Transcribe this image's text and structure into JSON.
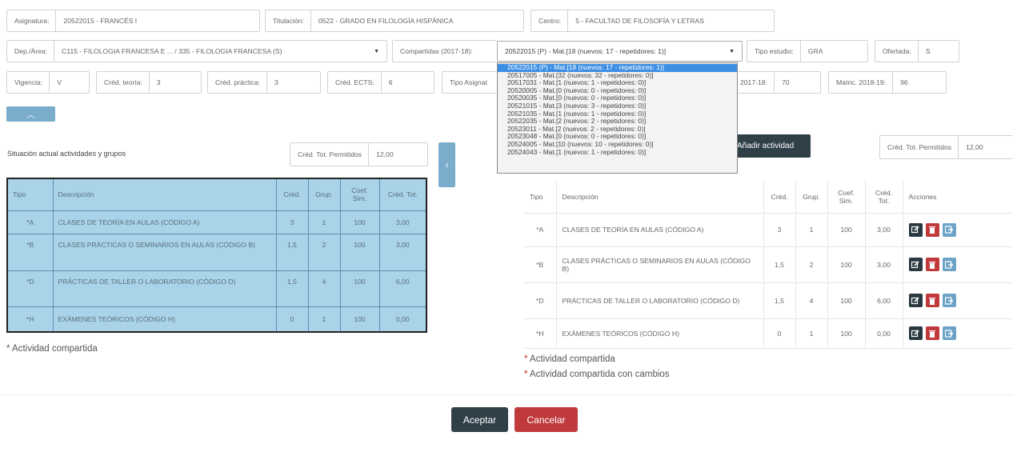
{
  "row1": {
    "asignatura": {
      "label": "Asignatura:",
      "value": "20522015 - FRANCÉS I"
    },
    "titulacion": {
      "label": "Titulación:",
      "value": "0522 - GRADO EN FILOLOGÍA HISPÁNICA"
    },
    "centro": {
      "label": "Centro:",
      "value": "5 - FACULTAD DE FILOSOFÍA Y LETRAS"
    }
  },
  "row2": {
    "dep_area": {
      "label": "Dep./Área:",
      "value": "C115 - FILOLOGIA FRANCESA E ... / 335 - FILOLOGIA FRANCESA (S)"
    },
    "compartidas": {
      "label": "Compartidas (2017-18):",
      "value": "20522015 (P) - Mat.[18 (nuevos: 17 - repetidores: 1)]"
    },
    "tipo_estudio": {
      "label": "Tipo estudio:",
      "value": "GRA"
    },
    "ofertada": {
      "label": "Ofertada:",
      "value": "S"
    }
  },
  "row3": {
    "vigencia": {
      "label": "Vigencia:",
      "value": "V"
    },
    "cred_teoria": {
      "label": "Créd. teoría:",
      "value": "3"
    },
    "cred_practica": {
      "label": "Créd. práctica:",
      "value": "3"
    },
    "cred_ects": {
      "label": "Créd. ECTS:",
      "value": "6"
    },
    "tipo_asignat": {
      "label": "Tipo Asignat"
    },
    "matric_2017": {
      "label": "2017-18:",
      "value": "70"
    },
    "matric_2018": {
      "label": "Matric. 2018-19:",
      "value": "96"
    }
  },
  "dropdown_options": [
    "20522015 (P) - Mat.[18 (nuevos: 17 - repetidores: 1)]",
    "20517005 - Mat.[32 (nuevos: 32 - repetidores: 0)]",
    "20517031 - Mat.[1 (nuevos: 1 - repetidores: 0)]",
    "20520005 - Mat.[0 (nuevos: 0 - repetidores: 0)]",
    "20520035 - Mat.[0 (nuevos: 0 - repetidores: 0)]",
    "20521015 - Mat.[3 (nuevos: 3 - repetidores: 0)]",
    "20521035 - Mat.[1 (nuevos: 1 - repetidores: 0)]",
    "20522035 - Mat.[2 (nuevos: 2 - repetidores: 0)]",
    "20523011 - Mat.[2 (nuevos: 2 - repetidores: 0)]",
    "20523048 - Mat.[0 (nuevos: 0 - repetidores: 0)]",
    "20524005 - Mat.[10 (nuevos: 10 - repetidores: 0)]",
    "20524043 - Mat.[1 (nuevos: 1 - repetidores: 0)]"
  ],
  "left": {
    "title": "Situación actual actividades y grupos",
    "cred_label": "Créd. Tot. Permitidos",
    "cred_value": "12,00",
    "headers": [
      "Tipo",
      "Descripción",
      "Créd.",
      "Grup.",
      "Coef. Sim.",
      "Créd. Tot."
    ],
    "rows": [
      [
        "*A",
        "CLASES DE TEORÍA EN AULAS (CÓDIGO A)",
        "3",
        "1",
        "100",
        "3,00"
      ],
      [
        "*B",
        "CLASES PRÁCTICAS O SEMINARIOS EN AULAS (CÓDIGO B)",
        "1,5",
        "2",
        "100",
        "3,00"
      ],
      [
        "*D",
        "PRÁCTICAS DE TALLER O LABORATORIO (CÓDIGO D)",
        "1,5",
        "4",
        "100",
        "6,00"
      ],
      [
        "*H",
        "EXÁMENES TEÓRICOS (CÓDIGO H)",
        "0",
        "1",
        "100",
        "0,00"
      ]
    ],
    "note": "* Actividad compartida"
  },
  "right": {
    "add_button": "Añadir actividad",
    "cred_label": "Créd. Tot. Permitidos",
    "cred_value": "12,00",
    "headers": [
      "Tipo",
      "Descripción",
      "Créd.",
      "Grup.",
      "Coef. Sim.",
      "Créd. Tot.",
      "Acciones"
    ],
    "rows": [
      [
        "*A",
        "CLASES DE TEORÍA EN AULAS (CÓDIGO A)",
        "3",
        "1",
        "100",
        "3,00"
      ],
      [
        "*B",
        "CLASES PRÁCTICAS O SEMINARIOS EN AULAS (CÓDIGO B)",
        "1,5",
        "2",
        "100",
        "3,00"
      ],
      [
        "*D",
        "PRÁCTICAS DE TALLER O LABORATORIO (CÓDIGO D)",
        "1,5",
        "4",
        "100",
        "6,00"
      ],
      [
        "*H",
        "EXÁMENES TEÓRICOS (CÓDIGO H)",
        "0",
        "1",
        "100",
        "0,00"
      ]
    ],
    "note1": "Actividad compartida",
    "note2": "Actividad compartida con cambios"
  },
  "buttons": {
    "accept": "Aceptar",
    "cancel": "Cancelar"
  },
  "colors": {
    "accent": "#7aaccb",
    "dark": "#2f4049",
    "danger": "#c0393b",
    "selected": "#3d8fe4"
  }
}
